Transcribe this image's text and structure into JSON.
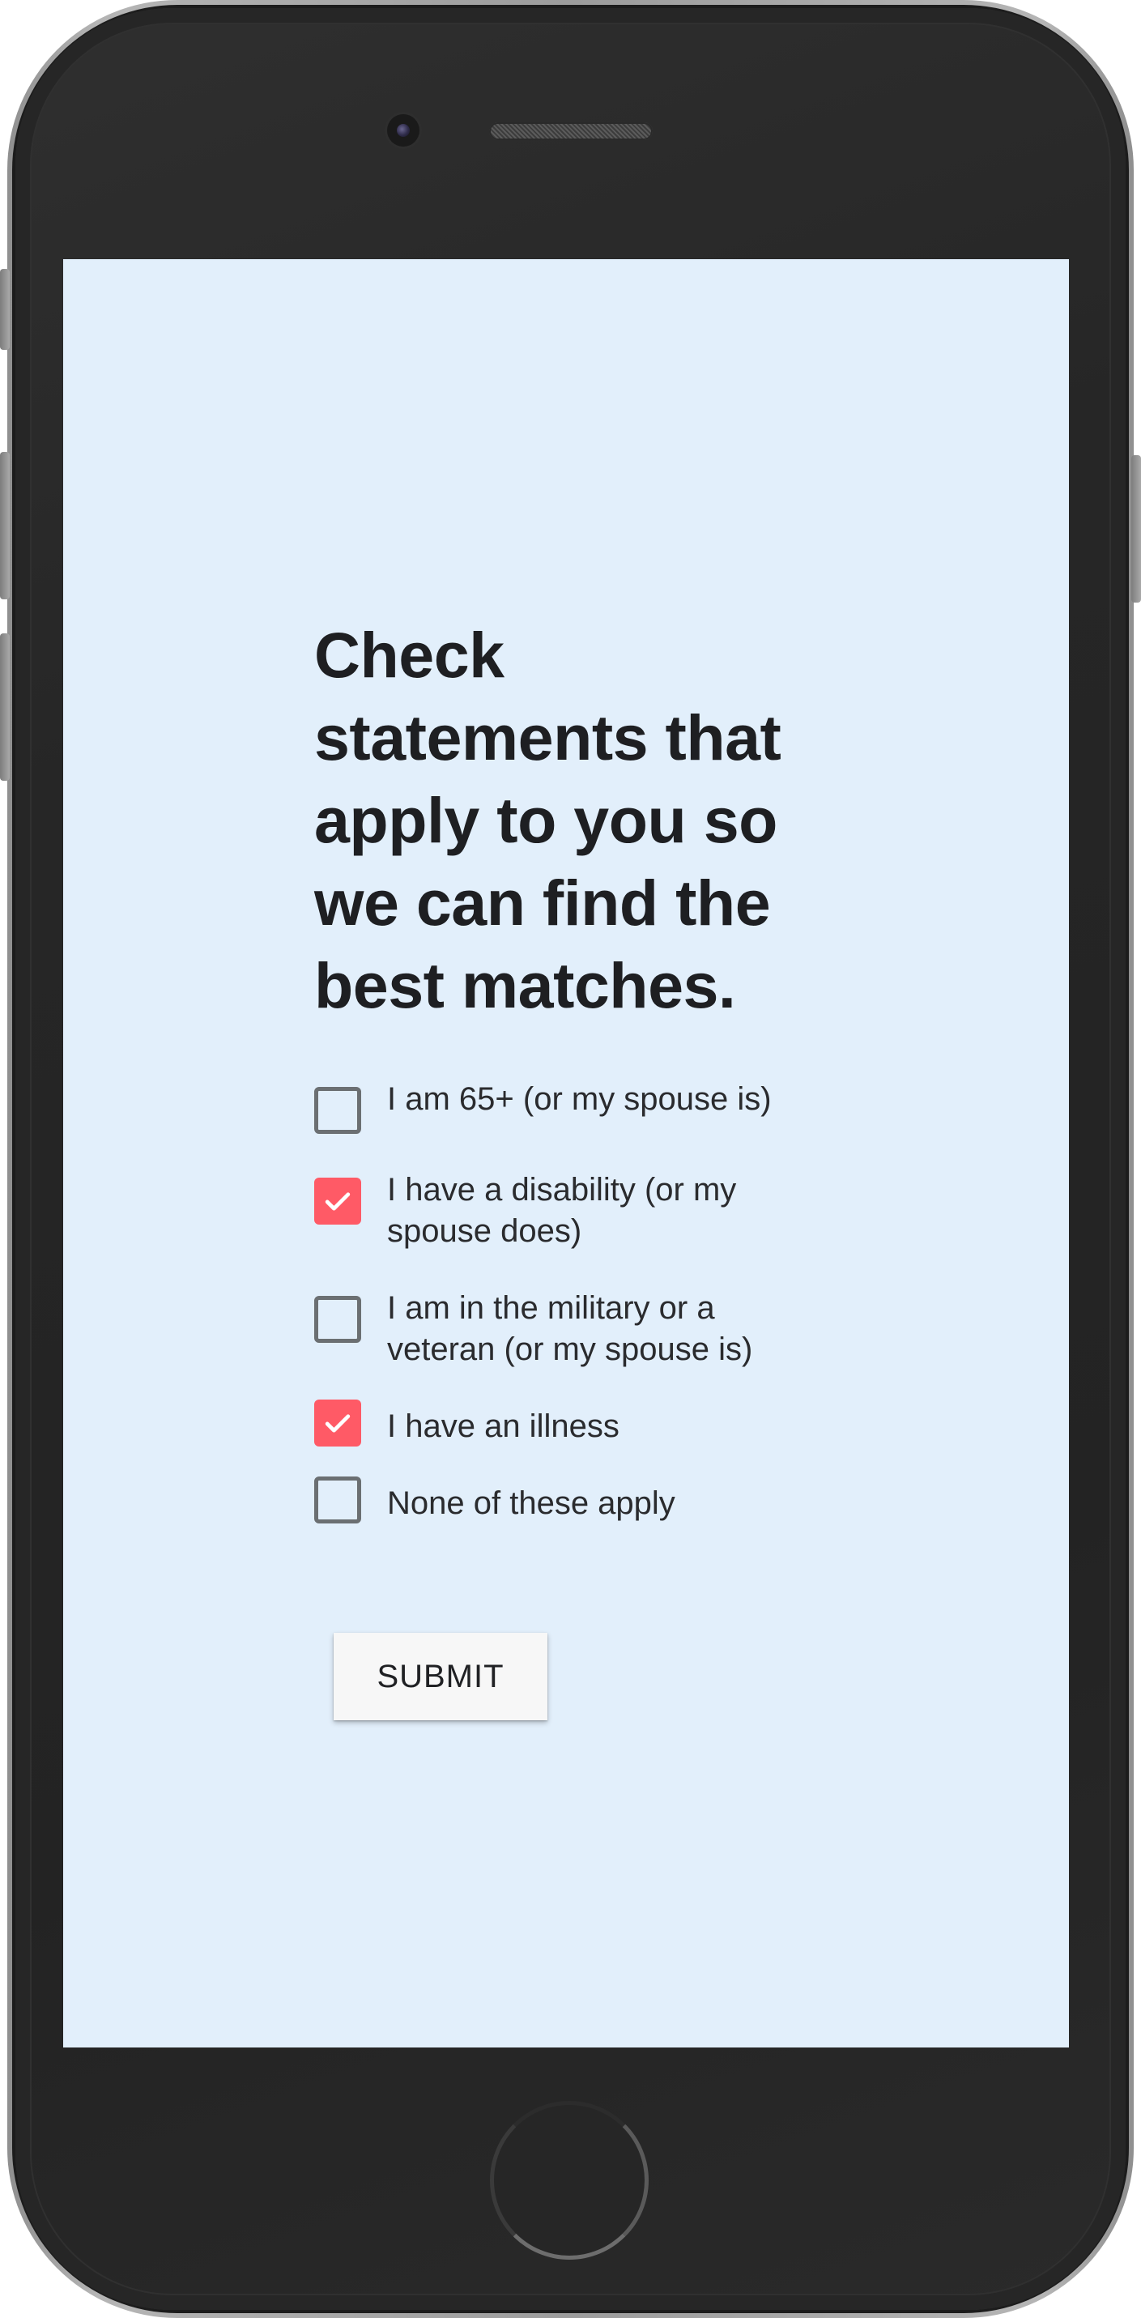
{
  "form": {
    "title": "Check statements that apply to you so we can find the best matches.",
    "options": [
      {
        "label": "I am 65+ (or my spouse is)",
        "checked": false
      },
      {
        "label": "I have a disability (or my spouse does)",
        "checked": true
      },
      {
        "label": "I am in the military or a veteran (or my spouse is)",
        "checked": false
      },
      {
        "label": "I have an illness",
        "checked": true
      },
      {
        "label": "None of these apply",
        "checked": false
      }
    ],
    "submit_label": "SUBMIT"
  },
  "colors": {
    "screen_background": "#e2effb",
    "checkbox_checked": "#ff5a66",
    "checkbox_unchecked_border": "#6b6f72",
    "title_text": "#1e1f22",
    "device_body": "#262626"
  },
  "icons": {
    "checkmark": "check-icon"
  }
}
